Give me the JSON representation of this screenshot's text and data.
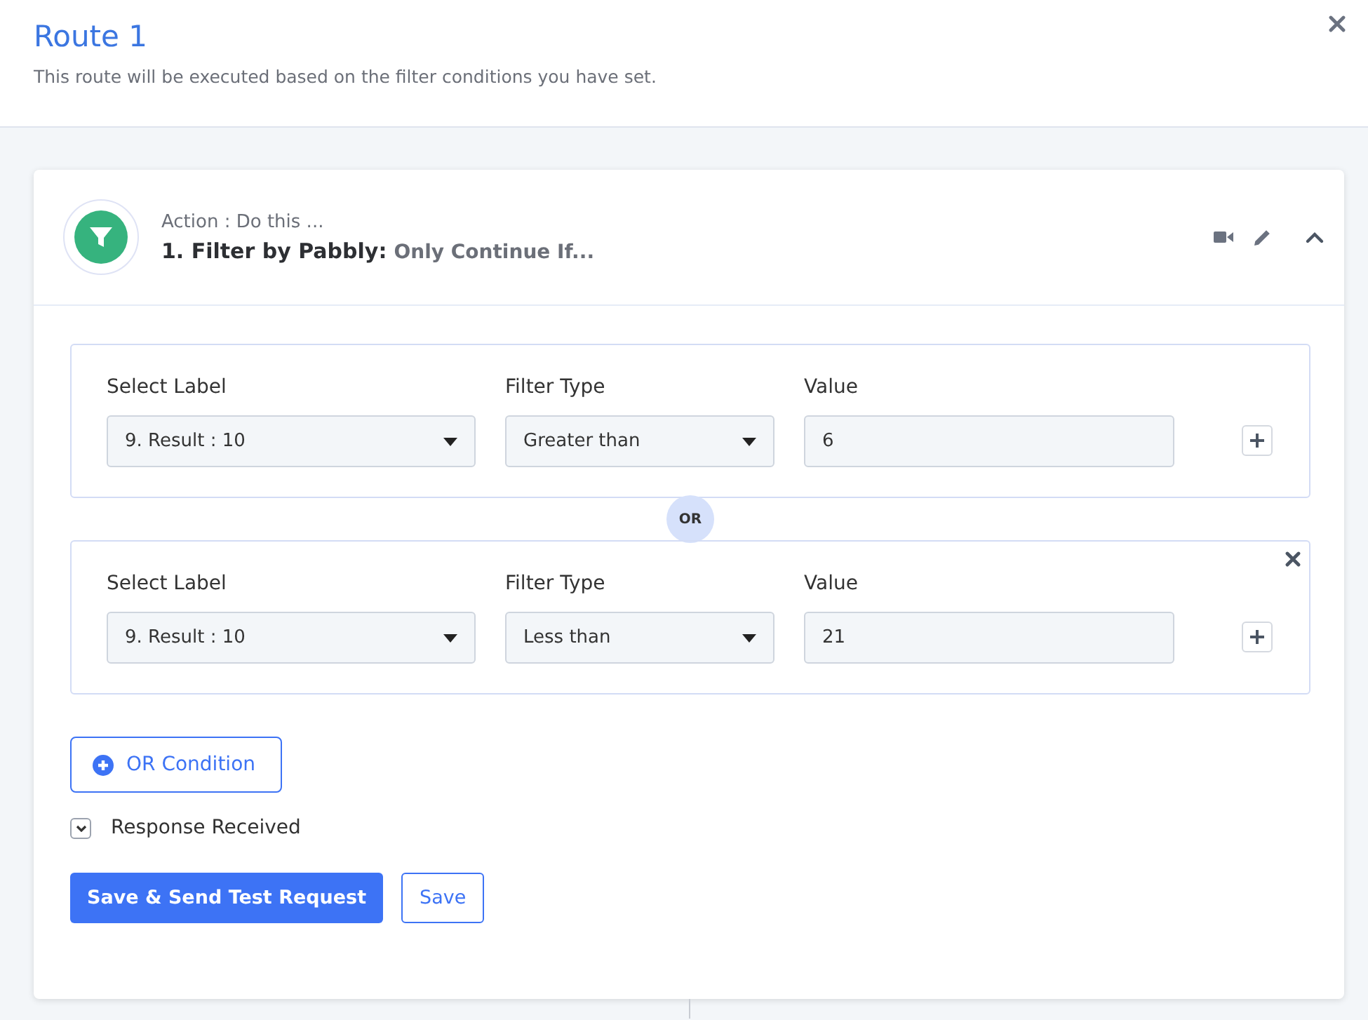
{
  "header": {
    "title": "Route 1",
    "subtitle": "This route will be executed based on the filter conditions you have set."
  },
  "action": {
    "caption": "Action : Do this ...",
    "name": "1. Filter by Pabbly:",
    "detail": "Only Continue If...",
    "expanded": true
  },
  "conditions": [
    {
      "removable": false,
      "fields": [
        {
          "label": "Select Label",
          "kind": "select",
          "value": "9. Result : 10"
        },
        {
          "label": "Filter Type",
          "kind": "select",
          "value": "Greater than"
        },
        {
          "label": "Value",
          "kind": "input",
          "value": "6"
        }
      ]
    },
    {
      "connector": "OR",
      "removable": true,
      "fields": [
        {
          "label": "Select Label",
          "kind": "select",
          "value": "9. Result : 10"
        },
        {
          "label": "Filter Type",
          "kind": "select",
          "value": "Less than"
        },
        {
          "label": "Value",
          "kind": "input",
          "value": "21"
        }
      ]
    }
  ],
  "add_condition": "OR Condition",
  "response": {
    "label": "Response Received",
    "expanded": false
  },
  "buttons": [
    {
      "label": "Save & Send Test Request",
      "kind": "primary"
    },
    {
      "label": "Save",
      "kind": "secondary"
    }
  ]
}
